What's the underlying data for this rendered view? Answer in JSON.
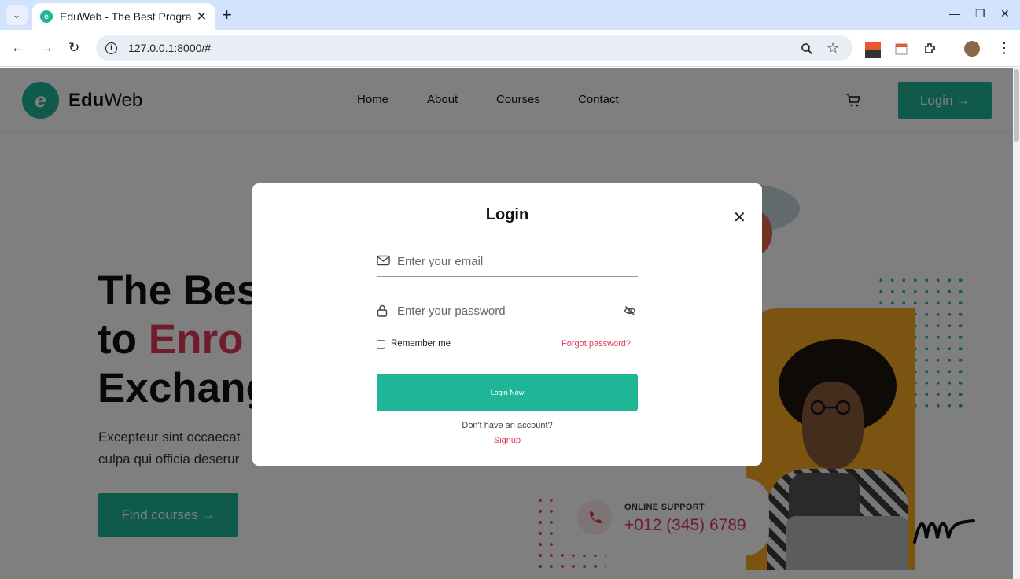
{
  "browser": {
    "tab_title": "EduWeb - The Best Programs",
    "tab_close": "✕",
    "new_tab": "+",
    "url": "127.0.0.1:8000/#"
  },
  "site": {
    "logo_letter": "e",
    "logo_bold": "Edu",
    "logo_light": "Web",
    "nav": [
      "Home",
      "About",
      "Courses",
      "Contact"
    ],
    "login_label": "Login →",
    "hero_line1": "The Best",
    "hero_line2_prefix": "to ",
    "hero_line2_accent": "Enro",
    "hero_line3": "Exchang",
    "hero_desc_line1": "Excepteur sint occaecat",
    "hero_desc_line2": "culpa qui officia deserur",
    "find_courses": "Find courses →",
    "support_label": "ONLINE SUPPORT",
    "support_phone": "+012 (345) 6789"
  },
  "modal": {
    "title": "Login",
    "close": "✕",
    "email_placeholder": "Enter your email",
    "password_placeholder": "Enter your password",
    "remember_label": "Remember me",
    "forgot_label": "Forgot password?",
    "submit_label": "Login Now",
    "no_account": "Don't have an account?",
    "signup_label": "Signup"
  },
  "colors": {
    "brand": "#1fb597",
    "accent": "#e1395b"
  },
  "icons": [
    "tab-dropdown-icon",
    "back-icon",
    "forward-icon",
    "reload-icon",
    "site-info-icon",
    "zoom-icon",
    "bookmark-star-icon",
    "extensions-icon",
    "menu-icon",
    "cart-icon",
    "mail-icon",
    "lock-icon",
    "eye-off-icon",
    "phone-icon",
    "close-icon"
  ]
}
